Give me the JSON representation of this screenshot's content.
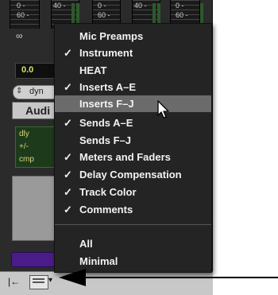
{
  "meters": {
    "m1_top": "0 -",
    "m1_mid": "60 -",
    "m2_top": "40 -",
    "m3_top": "0 -",
    "m3_mid": "60 -",
    "m4_top": "40 -",
    "m5_top": "0 -",
    "m5_mid": "60 -"
  },
  "fader": {
    "infinity": "∞",
    "gain": "0.0"
  },
  "dyn": {
    "arrow": "⇕",
    "label": "dyn"
  },
  "track_type": "Audi",
  "inserts": [
    "dly",
    "+/-",
    "cmp"
  ],
  "menu": {
    "items": [
      {
        "label": "Mic Preamps",
        "checked": ""
      },
      {
        "label": "Instrument",
        "checked": "✓"
      },
      {
        "label": "HEAT",
        "checked": ""
      },
      {
        "label": "Inserts A–E",
        "checked": "✓"
      },
      {
        "label": "Inserts F–J",
        "checked": ""
      },
      {
        "label": "Sends A–E",
        "checked": "✓"
      },
      {
        "label": "Sends F–J",
        "checked": ""
      },
      {
        "label": "Meters and Faders",
        "checked": "✓"
      },
      {
        "label": "Delay Compensation",
        "checked": "✓"
      },
      {
        "label": "Track Color",
        "checked": "✓"
      },
      {
        "label": "Comments",
        "checked": "✓"
      }
    ],
    "footer_items": [
      {
        "label": "All"
      },
      {
        "label": "Minimal"
      }
    ],
    "highlighted_item": "Inserts F–J"
  },
  "bottom_bar": {
    "collapse_glyph": "|←",
    "chevron_glyph": "▾"
  },
  "colors": {
    "menu_bg": "#242424",
    "highlight": "#6b6b6b",
    "gain_text": "#d7e36b",
    "insert_bg": "#1d3a1b",
    "purple": "#4a1d8a"
  }
}
